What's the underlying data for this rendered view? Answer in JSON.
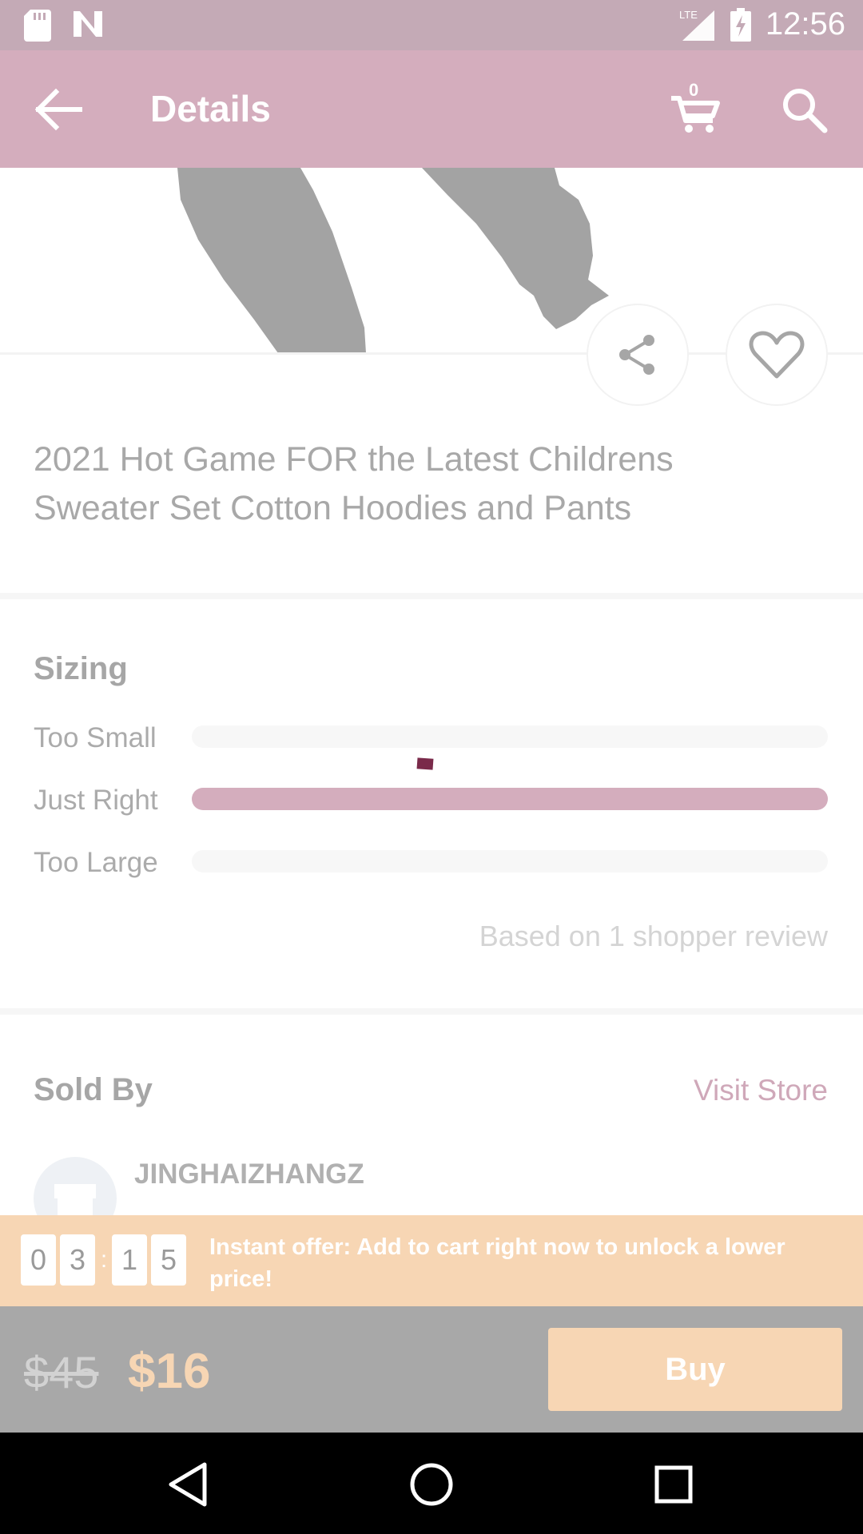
{
  "status_bar": {
    "time": "12:56",
    "network_label": "LTE"
  },
  "app_bar": {
    "title": "Details",
    "cart_count": "0"
  },
  "product": {
    "title": "2021 Hot Game FOR the Latest Childrens Sweater Set Cotton Hoodies and Pants"
  },
  "sizing": {
    "heading": "Sizing",
    "rows": [
      {
        "label": "Too Small",
        "fraction": 0
      },
      {
        "label": "Just Right",
        "fraction": 1
      },
      {
        "label": "Too Large",
        "fraction": 0
      }
    ],
    "based_on": "Based on 1 shopper review"
  },
  "seller": {
    "heading": "Sold By",
    "visit_store_label": "Visit Store",
    "store_name": "JINGHAIZHANGZ"
  },
  "offer": {
    "timer_digits": [
      "0",
      "3",
      "1",
      "5"
    ],
    "timer_separator": ":",
    "text": "Instant offer: Add to cart right now to unlock a lower price!"
  },
  "buy_bar": {
    "old_price": "$45",
    "new_price": "$16",
    "buy_label": "Buy"
  },
  "colors": {
    "accent": "#d4adbd",
    "status_bar": "#c4aab6",
    "offer": "#f7d6b4",
    "overlay_gray": "#a8a8a8"
  },
  "icons": {
    "back": "arrow-left-icon",
    "cart": "cart-icon",
    "search": "search-icon",
    "share": "share-icon",
    "favorite": "heart-icon",
    "store": "store-icon"
  }
}
